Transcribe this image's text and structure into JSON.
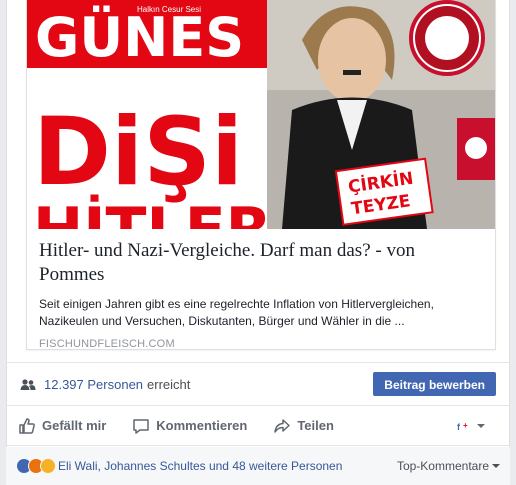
{
  "link_preview": {
    "image": {
      "masthead": "GÜNES",
      "masthead_tagline": "Halkın Cesur Sesi",
      "headline": "DiŞi",
      "headline_partial": "HİTLER",
      "badge_line1": "ÇİRKİN",
      "badge_line2": "TEYZE",
      "colors": {
        "red": "#e30613",
        "black": "#111111",
        "white": "#ffffff"
      }
    },
    "title": "Hitler- und Nazi-Vergleiche. Darf man das? - von Pommes",
    "description": "Seit einigen Jahren gibt es eine regelrechte Inflation von Hitlervergleichen, Nazikeulen und Versuchen, Diskutanten, Bürger und Wähler in die ...",
    "domain": "FISCHUNDFLEISCH.COM"
  },
  "reach": {
    "icon": "people-icon",
    "count": "12.397 Personen",
    "label": "erreicht",
    "boost_label": "Beitrag bewerben"
  },
  "actions": {
    "like_label": "Gefällt mir",
    "comment_label": "Kommentieren",
    "share_label": "Teilen"
  },
  "reactions": {
    "types": [
      "like",
      "angry",
      "haha"
    ],
    "summary": "Eli Wali, Johannes Schultes und 48 weitere Personen",
    "top_comments_label": "Top-Kommentare"
  },
  "colors": {
    "link": "#365899",
    "button": "#4267b2",
    "muted": "#616770"
  }
}
